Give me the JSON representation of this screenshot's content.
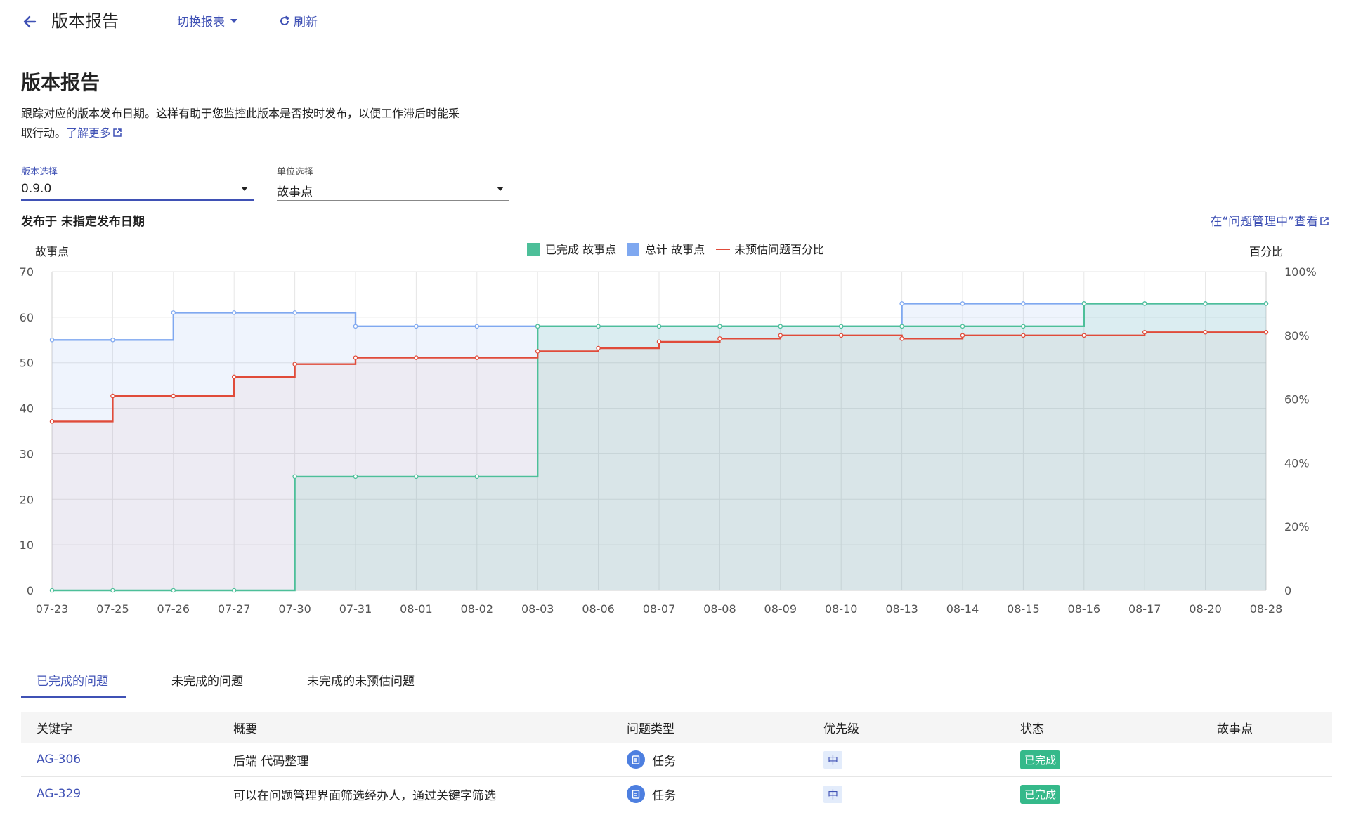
{
  "header": {
    "title": "版本报告",
    "switch_label": "切换报表",
    "refresh_label": "刷新"
  },
  "page": {
    "title": "版本报告",
    "description_line1": "跟踪对应的版本发布日期。这样有助于您监控此版本是否按时发布，以便工作滞后时能采",
    "description_line2": "取行动。",
    "learn_more": "了解更多"
  },
  "filters": {
    "version_label": "版本选择",
    "version_value": "0.9.0",
    "unit_label": "单位选择",
    "unit_value": "故事点"
  },
  "release_info": "发布于 未指定发布日期",
  "issue_link": "在“问题管理中”查看",
  "colors": {
    "accent": "#3f51b5",
    "completed": "#4dbf99",
    "total": "#7fa8f0",
    "unestimated": "#e04b3a"
  },
  "chart_data": {
    "type": "line",
    "x": [
      "07-23",
      "07-25",
      "07-26",
      "07-27",
      "07-30",
      "07-31",
      "08-01",
      "08-02",
      "08-03",
      "08-06",
      "08-07",
      "08-08",
      "08-09",
      "08-10",
      "08-13",
      "08-14",
      "08-15",
      "08-16",
      "08-17",
      "08-20",
      "08-28"
    ],
    "left_axis_title": "故事点",
    "right_axis_title": "百分比",
    "ylim": [
      0,
      70
    ],
    "yticks": [
      "0",
      "10",
      "20",
      "30",
      "40",
      "50",
      "60",
      "70"
    ],
    "y2lim": [
      0,
      100
    ],
    "y2ticks": [
      "0",
      "20%",
      "40%",
      "60%",
      "80%",
      "100%"
    ],
    "legend_position": "top-center",
    "grid": true,
    "step": true,
    "series": [
      {
        "name": "已完成 故事点",
        "style": "area",
        "color": "#4dbf99",
        "values": [
          0,
          0,
          0,
          0,
          25,
          25,
          25,
          25,
          58,
          58,
          58,
          58,
          58,
          58,
          58,
          58,
          58,
          63,
          63,
          63,
          63
        ]
      },
      {
        "name": "总计 故事点",
        "style": "area",
        "color": "#7fa8f0",
        "values": [
          55,
          55,
          61,
          61,
          61,
          58,
          58,
          58,
          58,
          58,
          58,
          58,
          58,
          58,
          63,
          63,
          63,
          63,
          63,
          63,
          63
        ]
      },
      {
        "name": "未预估问题百分比",
        "style": "line",
        "color": "#e04b3a",
        "axis": "right",
        "values": [
          53,
          61,
          61,
          67,
          71,
          73,
          73,
          73,
          75,
          76,
          78,
          79,
          80,
          80,
          79,
          80,
          80,
          80,
          81,
          81,
          81
        ]
      }
    ]
  },
  "tabs": [
    "已完成的问题",
    "未完成的问题",
    "未完成的未预估问题"
  ],
  "table": {
    "columns": [
      "关键字",
      "概要",
      "问题类型",
      "优先级",
      "状态",
      "故事点"
    ],
    "rows": [
      {
        "key": "AG-306",
        "summary": "后端 代码整理",
        "type": "任务",
        "priority": "中",
        "status": "已完成",
        "points": ""
      },
      {
        "key": "AG-329",
        "summary": "可以在问题管理界面筛选经办人，通过关键字筛选",
        "type": "任务",
        "priority": "中",
        "status": "已完成",
        "points": ""
      }
    ]
  }
}
